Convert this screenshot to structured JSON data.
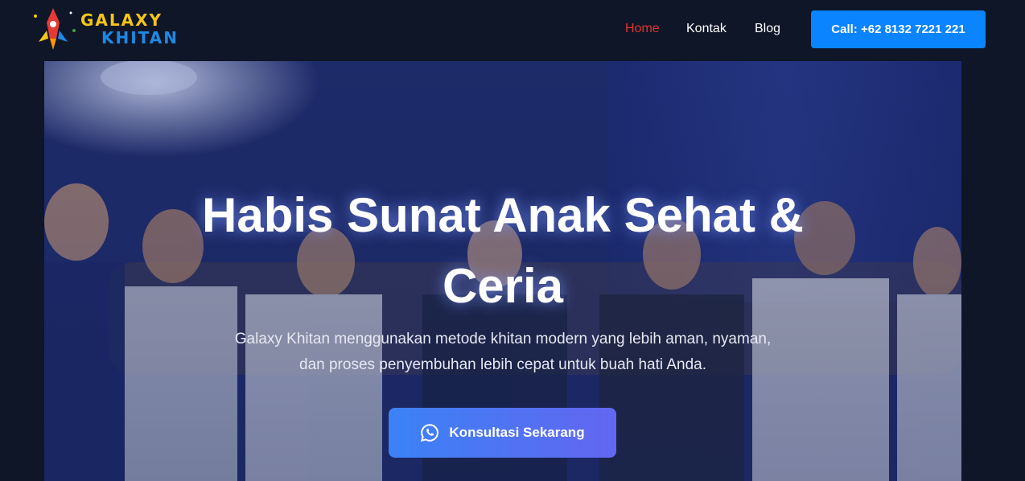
{
  "brand": {
    "name_line1": "GALAXY",
    "name_line2": "KHITAN",
    "logo_icon": "rocket-icon"
  },
  "nav": {
    "items": [
      {
        "label": "Home",
        "active": true
      },
      {
        "label": "Kontak",
        "active": false
      },
      {
        "label": "Blog",
        "active": false
      }
    ],
    "call_label": "Call: +62 8132 7221 221"
  },
  "hero": {
    "title": "Habis Sunat Anak Sehat & Ceria",
    "subtitle": "Galaxy Khitan menggunakan metode khitan modern yang lebih aman, nyaman, dan proses penyembuhan lebih cepat untuk buah hati Anda.",
    "cta_label": "Konsultasi Sekarang",
    "cta_icon": "whatsapp-icon"
  },
  "colors": {
    "background": "#0e1628",
    "active_nav": "#e3342f",
    "call_button": "#0a84ff",
    "cta_start": "#3b82f6",
    "cta_end": "#6366f1"
  }
}
